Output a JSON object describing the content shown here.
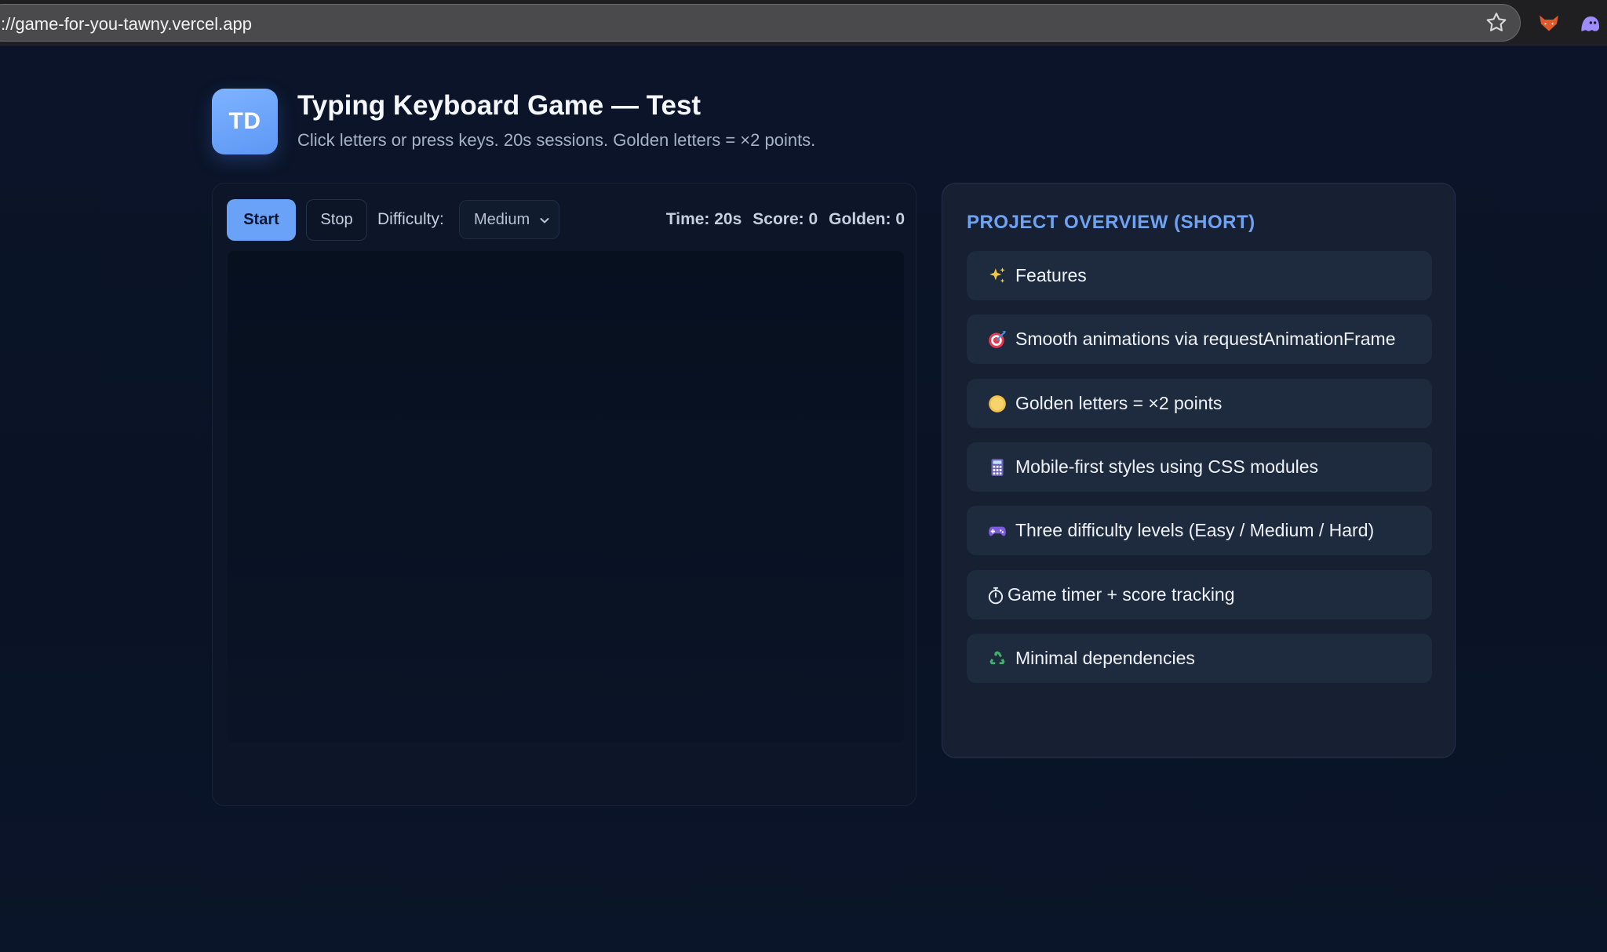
{
  "browser": {
    "url": "://game-for-you-tawny.vercel.app"
  },
  "header": {
    "avatar_initials": "TD",
    "title": "Typing Keyboard Game — Test",
    "subtitle": "Click letters or press keys. 20s sessions. Golden letters = ×2 points."
  },
  "game": {
    "start_label": "Start",
    "stop_label": "Stop",
    "difficulty_label": "Difficulty:",
    "difficulty_value": "Medium",
    "time": "Time: 20s",
    "score": "Score: 0",
    "golden": "Golden: 0"
  },
  "overview": {
    "title": "PROJECT OVERVIEW (SHORT)",
    "items": [
      {
        "icon": "sparkles-icon",
        "label": "Features"
      },
      {
        "icon": "target-icon",
        "label": "Smooth animations via requestAnimationFrame"
      },
      {
        "icon": "gold-coin-icon",
        "label": "Golden letters = ×2 points"
      },
      {
        "icon": "abacus-icon",
        "label": "Mobile-first styles using CSS modules"
      },
      {
        "icon": "gamepad-icon",
        "label": "Three difficulty levels (Easy / Medium / Hard)"
      },
      {
        "icon": "stopwatch-icon",
        "label": "Game timer + score tracking"
      },
      {
        "icon": "recycle-icon",
        "label": "Minimal dependencies"
      }
    ]
  },
  "colors": {
    "page_bg": "#0a1224",
    "accent": "#6aa2f7",
    "overview_title": "#6fa3f2"
  }
}
